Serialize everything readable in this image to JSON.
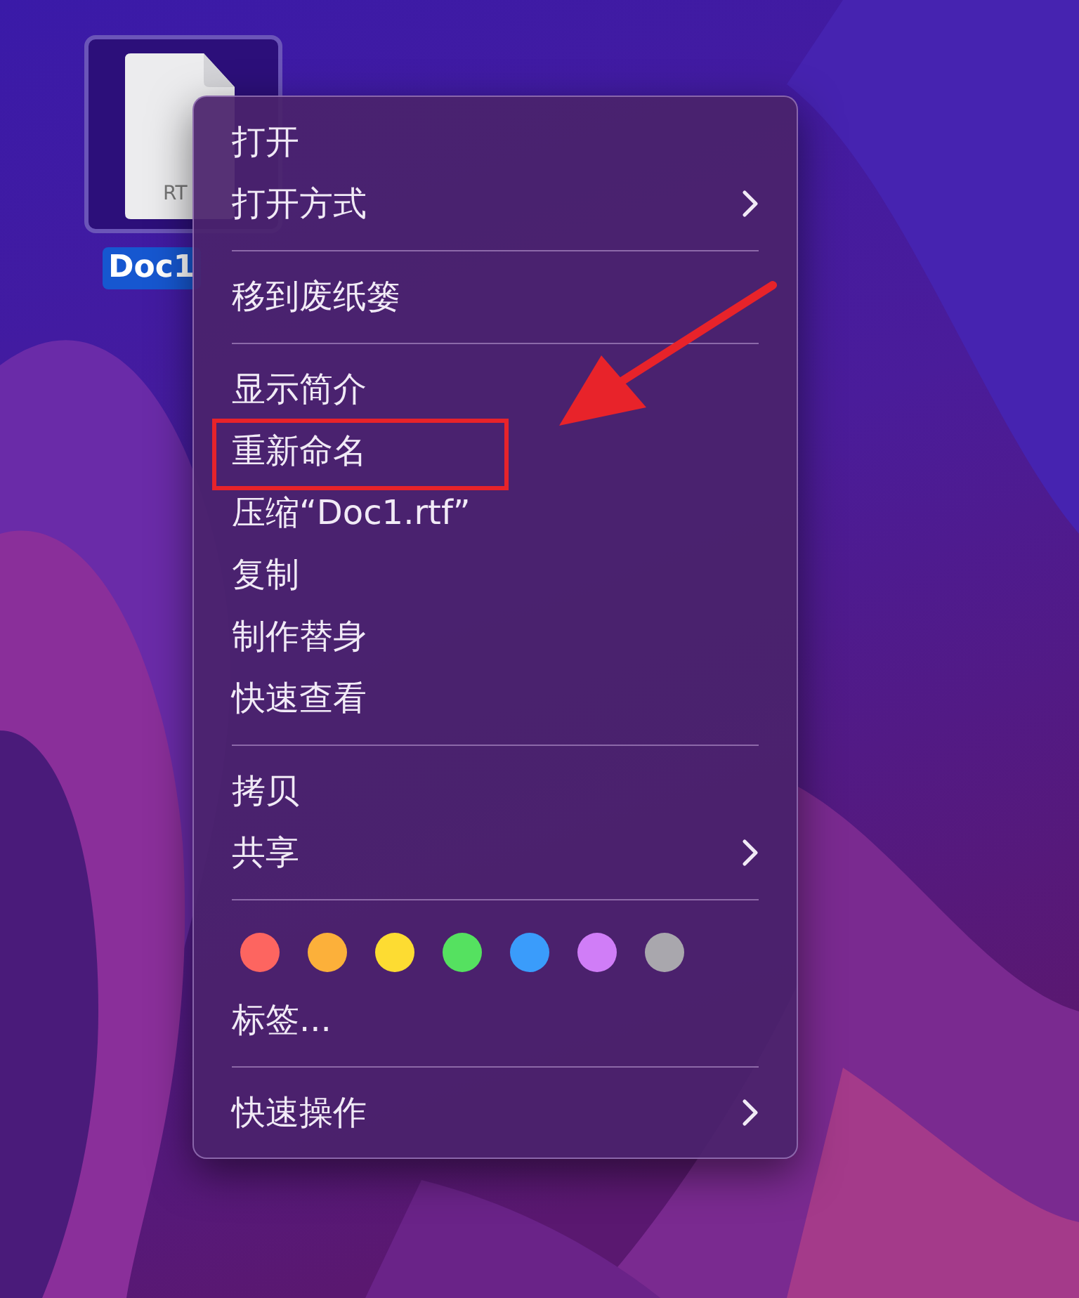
{
  "desktop_icon": {
    "label": "Doc1",
    "file_badge": "RT",
    "selected": true
  },
  "menu": {
    "items": [
      {
        "kind": "item",
        "label": "打开",
        "submenu": false,
        "highlighted": false
      },
      {
        "kind": "item",
        "label": "打开方式",
        "submenu": true,
        "highlighted": false
      },
      {
        "kind": "separator"
      },
      {
        "kind": "item",
        "label": "移到废纸篓",
        "submenu": false,
        "highlighted": false
      },
      {
        "kind": "separator"
      },
      {
        "kind": "item",
        "label": "显示简介",
        "submenu": false,
        "highlighted": false
      },
      {
        "kind": "item",
        "label": "重新命名",
        "submenu": false,
        "highlighted": true
      },
      {
        "kind": "item",
        "label": "压缩“Doc1.rtf”",
        "submenu": false,
        "highlighted": false
      },
      {
        "kind": "item",
        "label": "复制",
        "submenu": false,
        "highlighted": false
      },
      {
        "kind": "item",
        "label": "制作替身",
        "submenu": false,
        "highlighted": false
      },
      {
        "kind": "item",
        "label": "快速查看",
        "submenu": false,
        "highlighted": false
      },
      {
        "kind": "separator"
      },
      {
        "kind": "item",
        "label": "拷贝",
        "submenu": false,
        "highlighted": false
      },
      {
        "kind": "item",
        "label": "共享",
        "submenu": true,
        "highlighted": false
      },
      {
        "kind": "separator"
      },
      {
        "kind": "tags",
        "tags": [
          {
            "color": "#fd6560"
          },
          {
            "color": "#fcb03a"
          },
          {
            "color": "#fddc32"
          },
          {
            "color": "#55e160"
          },
          {
            "color": "#3a9cfb"
          },
          {
            "color": "#d07df7"
          },
          {
            "color": "#a9a7ad"
          }
        ]
      },
      {
        "kind": "item",
        "label": "标签...",
        "submenu": false,
        "highlighted": false
      },
      {
        "kind": "separator"
      },
      {
        "kind": "item",
        "label": "快速操作",
        "submenu": true,
        "highlighted": false
      }
    ]
  }
}
